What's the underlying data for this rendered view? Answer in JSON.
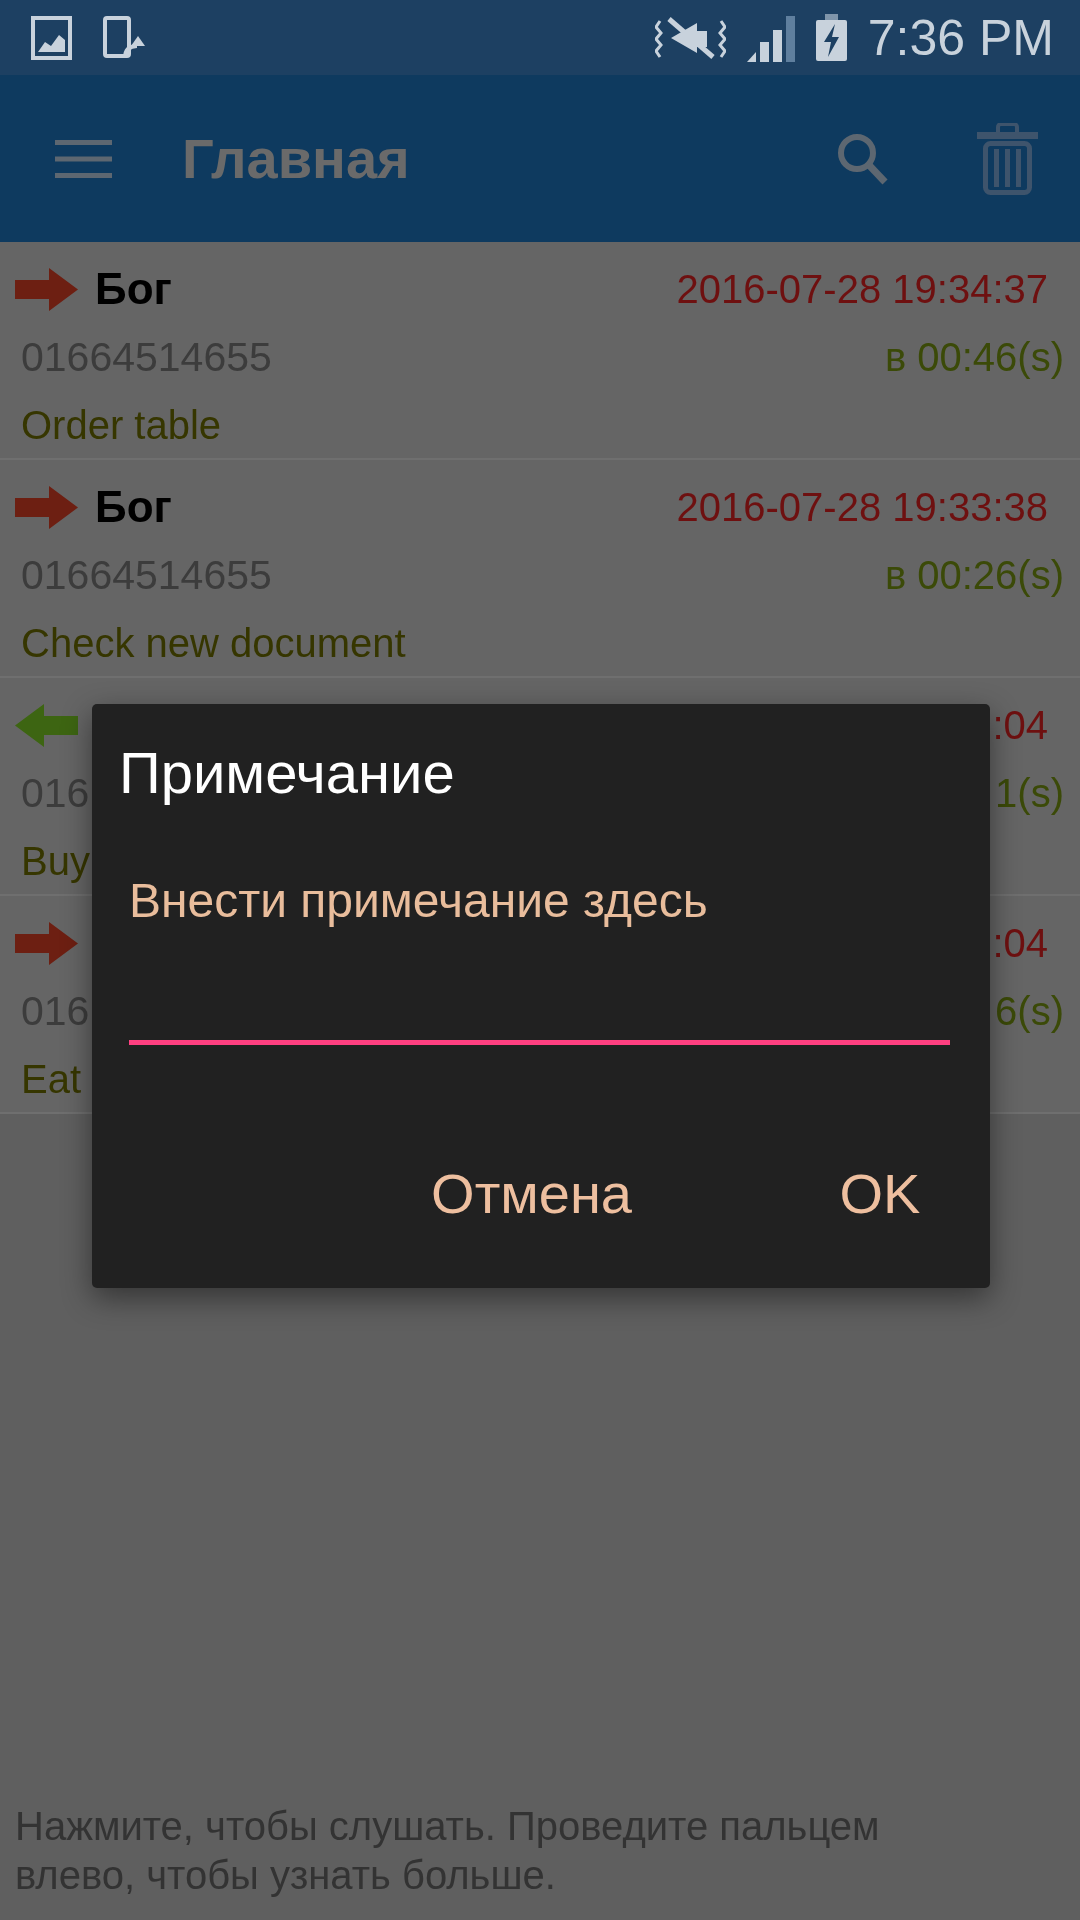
{
  "status_bar": {
    "time": "7:36 PM"
  },
  "toolbar": {
    "title": "Главная"
  },
  "calls": [
    {
      "kind": "outgoing",
      "name": "Бог",
      "time": "2016-07-28 19:34:37",
      "number": "01664514655",
      "duration": "в 00:46(s)",
      "note": "Order table"
    },
    {
      "kind": "outgoing",
      "name": "Бог",
      "time": "2016-07-28 19:33:38",
      "number": "01664514655",
      "duration": "в 00:26(s)",
      "note": "Check new document"
    },
    {
      "kind": "incoming",
      "time": ":04",
      "number": "016",
      "duration": "1(s)",
      "note": "Buy"
    },
    {
      "kind": "outgoing",
      "time": ":04",
      "number": "016",
      "duration": "6(s)",
      "note": "Eat"
    }
  ],
  "dialog": {
    "title": "Примечание",
    "message": "Внести примечание здесь",
    "note_field": {
      "focused": true
    },
    "buttons": [
      {
        "label": "Отмена"
      },
      {
        "label": "OK"
      }
    ]
  },
  "hint_text": "Нажмите, чтобы слушать. Проведите пальцем влево, чтобы узнать больше."
}
